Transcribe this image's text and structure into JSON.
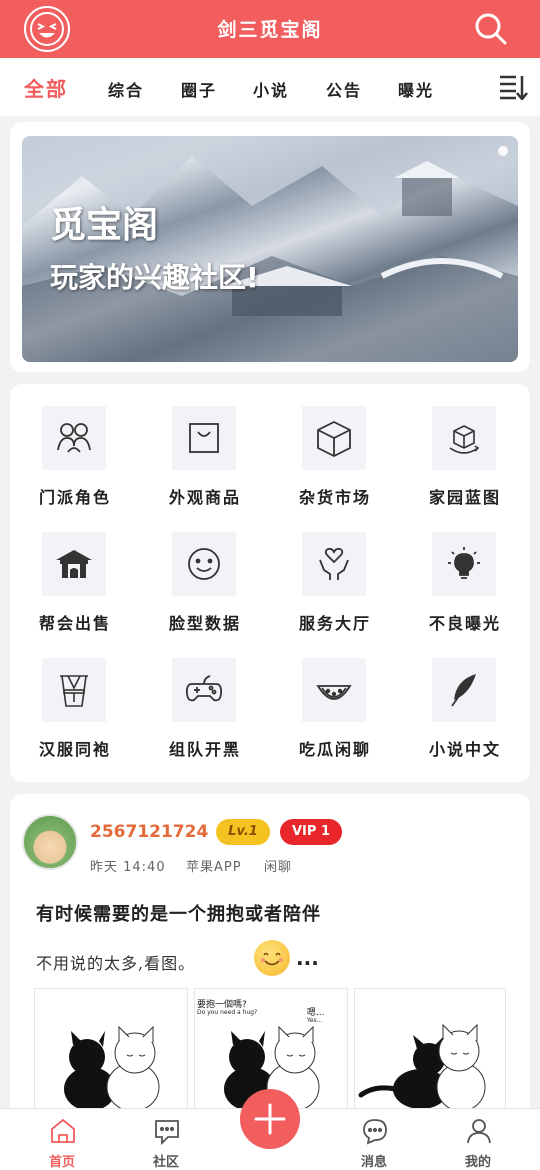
{
  "header": {
    "title": "剑三觅宝阁",
    "logo_icon": "laughing-face-icon",
    "search_icon": "search-icon"
  },
  "tabs": [
    {
      "label": "全部",
      "active": true
    },
    {
      "label": "综合"
    },
    {
      "label": "圈子"
    },
    {
      "label": "小说"
    },
    {
      "label": "公告"
    },
    {
      "label": "曝光"
    }
  ],
  "banner": {
    "title": "觅宝阁",
    "subtitle": "玩家的兴趣社区!"
  },
  "categories": [
    {
      "label": "门派角色",
      "icon": "people-icon"
    },
    {
      "label": "外观商品",
      "icon": "shopping-bag-icon"
    },
    {
      "label": "杂货市场",
      "icon": "box-icon"
    },
    {
      "label": "家园蓝图",
      "icon": "cube-rotate-icon"
    },
    {
      "label": "帮会出售",
      "icon": "pavilion-icon"
    },
    {
      "label": "脸型数据",
      "icon": "face-icon"
    },
    {
      "label": "服务大厅",
      "icon": "heart-hands-icon"
    },
    {
      "label": "不良曝光",
      "icon": "lightbulb-icon"
    },
    {
      "label": "汉服同袍",
      "icon": "hanfu-icon"
    },
    {
      "label": "组队开黑",
      "icon": "gamepad-icon"
    },
    {
      "label": "吃瓜闲聊",
      "icon": "watermelon-icon"
    },
    {
      "label": "小说中文",
      "icon": "feather-icon"
    }
  ],
  "post": {
    "username": "2567121724",
    "level": "Lv.1",
    "vip": "VIP 1",
    "time": "昨天 14:40",
    "source": "苹果APP",
    "category": "闲聊",
    "title": "有时候需要的是一个拥抱或者陪伴",
    "body": "不用说的太多,看图。",
    "ellipsis": "...",
    "thumb2_caption": "要抱一個嗎?",
    "thumb2_caption_en": "Do you need a hug?",
    "thumb2_reply": "嗯...",
    "thumb2_reply_en": "Yes..."
  },
  "bottom_nav": [
    {
      "label": "首页",
      "icon": "home-icon",
      "active": true
    },
    {
      "label": "社区",
      "icon": "chat-dots-icon"
    },
    {
      "label": "消息",
      "icon": "message-icon"
    },
    {
      "label": "我的",
      "icon": "user-icon"
    }
  ],
  "colors": {
    "accent": "#f25d5d",
    "username": "#e56a3a",
    "lv_badge": "#f5c321",
    "vip_badge": "#e8262b"
  }
}
